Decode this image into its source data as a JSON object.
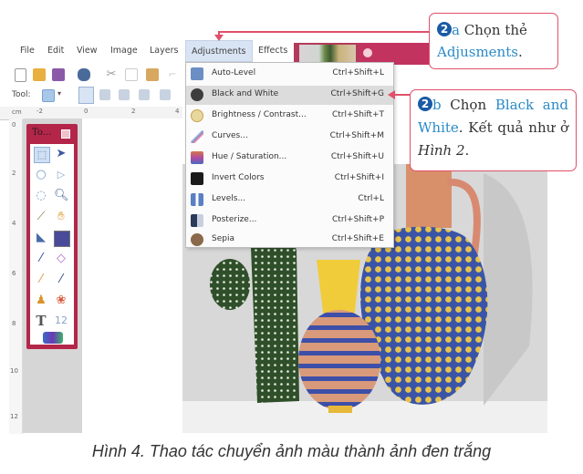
{
  "menubar": {
    "items": [
      {
        "label": "File"
      },
      {
        "label": "Edit"
      },
      {
        "label": "View"
      },
      {
        "label": "Image"
      },
      {
        "label": "Layers"
      },
      {
        "label": "Adjustments",
        "active": true
      },
      {
        "label": "Effects"
      }
    ]
  },
  "toolbar": {
    "icons": [
      "new-file-icon",
      "open-folder-icon",
      "save-icon",
      "print-icon",
      "cut-icon",
      "copy-icon",
      "paste-icon",
      "crop-icon"
    ],
    "tool_label": "Tool:",
    "selection_modes": [
      "replace",
      "union",
      "exclude",
      "intersect",
      "xor"
    ]
  },
  "ruler": {
    "unit": "cm",
    "h_ticks": [
      "-2",
      "0",
      "2",
      "4"
    ],
    "v_ticks": [
      "0",
      "2",
      "4",
      "6",
      "8",
      "10",
      "12"
    ]
  },
  "toolbox": {
    "title": "To...",
    "tools": [
      "rectangle-select",
      "move-selection",
      "lasso-select",
      "move-selected",
      "ellipse-select",
      "zoom",
      "magic-wand",
      "pan",
      "paint-bucket",
      "gradient",
      "paintbrush",
      "eraser",
      "pencil",
      "color-picker",
      "clone-stamp",
      "recolor",
      "text",
      "line-curve",
      "shapes"
    ]
  },
  "adjustments_menu": {
    "items": [
      {
        "label": "Auto-Level",
        "shortcut": "Ctrl+Shift+L",
        "icon": "auto-level-icon",
        "color": "#6b8fc4"
      },
      {
        "label": "Black and White",
        "shortcut": "Ctrl+Shift+G",
        "icon": "black-white-icon",
        "color": "#3d3d3d",
        "highlighted": true
      },
      {
        "label": "Brightness / Contrast...",
        "shortcut": "Ctrl+Shift+T",
        "icon": "brightness-icon",
        "color": "#c9a34a"
      },
      {
        "label": "Curves...",
        "shortcut": "Ctrl+Shift+M",
        "icon": "curves-icon",
        "color": "#7a9fd6"
      },
      {
        "label": "Hue / Saturation...",
        "shortcut": "Ctrl+Shift+U",
        "icon": "hue-saturation-icon",
        "color": "#d4784a"
      },
      {
        "label": "Invert Colors",
        "shortcut": "Ctrl+Shift+I",
        "icon": "invert-colors-icon",
        "color": "#1a1a1a"
      },
      {
        "label": "Levels...",
        "shortcut": "Ctrl+L",
        "icon": "levels-icon",
        "color": "#5a7fc4"
      },
      {
        "label": "Posterize...",
        "shortcut": "Ctrl+Shift+P",
        "icon": "posterize-icon",
        "color": "#4a5a7a"
      },
      {
        "label": "Sepia",
        "shortcut": "Ctrl+Shift+E",
        "icon": "sepia-icon",
        "color": "#8a6a4a"
      }
    ]
  },
  "callouts": {
    "a": {
      "number": "2",
      "letter": "a",
      "text_before": "Chọn thẻ",
      "highlight": "Adjusments",
      "text_after": "."
    },
    "b": {
      "number": "2",
      "letter": "b",
      "text_before": "Chọn",
      "highlight": "Black and White",
      "text_after": ". Kết quả như ở",
      "ref_italic": "Hình 2",
      "end": "."
    }
  },
  "caption": "Hình 4. Thao tác chuyển ảnh màu thành ảnh đen trắng",
  "colors": {
    "accent_pink": "#e0506a",
    "callout_blue": "#2a8ac7",
    "number_badge": "#1a5aa6",
    "window_frame": "#b3264a"
  }
}
